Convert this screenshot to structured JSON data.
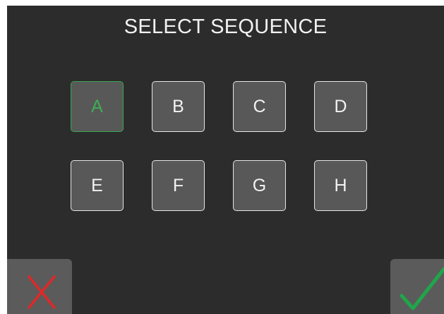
{
  "title": "SELECT SEQUENCE",
  "sequences": [
    {
      "label": "A",
      "selected": true
    },
    {
      "label": "B",
      "selected": false
    },
    {
      "label": "C",
      "selected": false
    },
    {
      "label": "D",
      "selected": false
    },
    {
      "label": "E",
      "selected": false
    },
    {
      "label": "F",
      "selected": false
    },
    {
      "label": "G",
      "selected": false
    },
    {
      "label": "H",
      "selected": false
    }
  ],
  "actions": {
    "cancel_icon": "x-icon",
    "confirm_icon": "checkmark-icon"
  },
  "colors": {
    "background": "#2c2c2c",
    "button": "#585858",
    "selected": "#3aa652",
    "cancel": "#e02828",
    "confirm": "#1fa64a"
  }
}
